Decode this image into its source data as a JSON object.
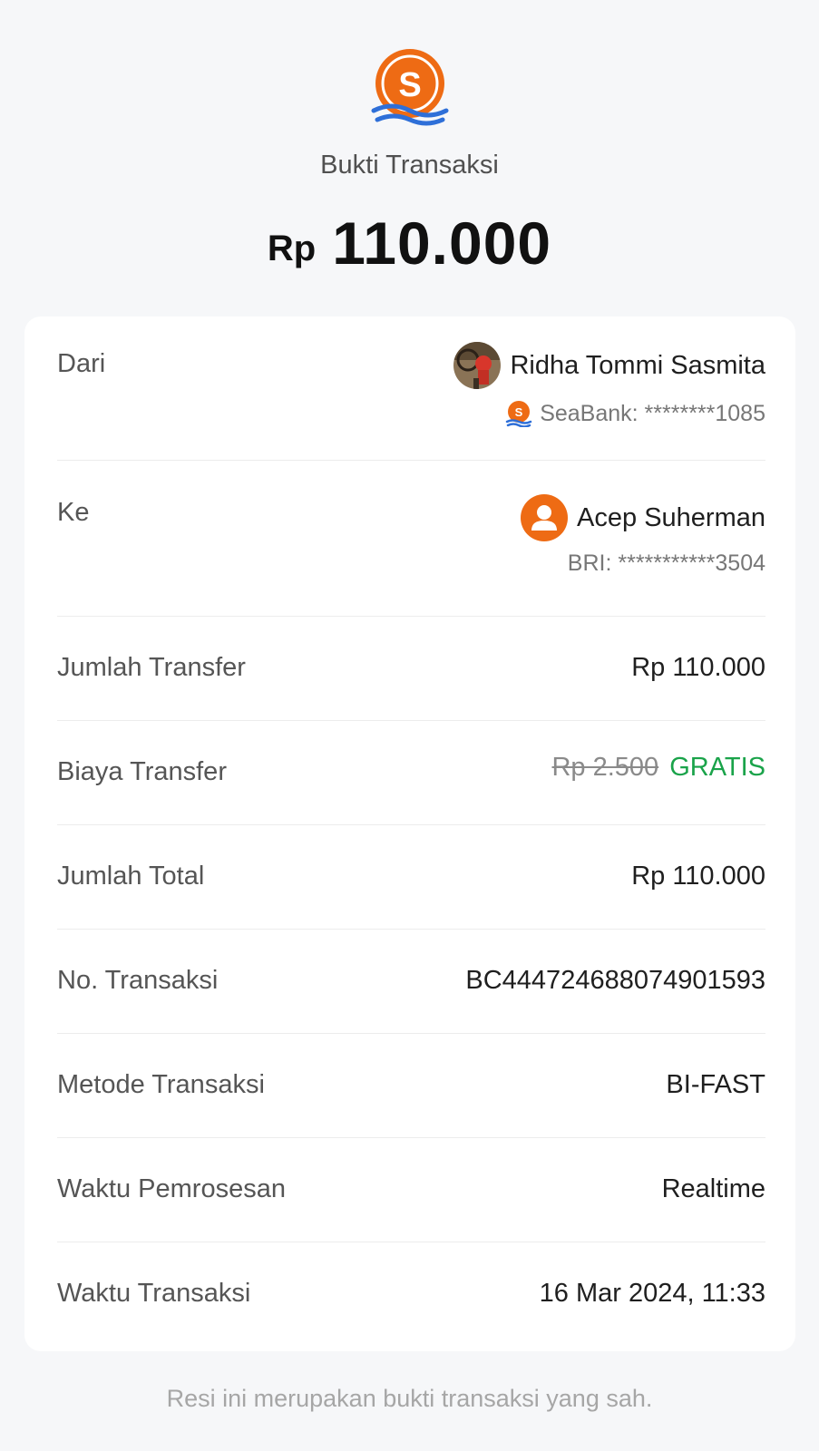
{
  "header": {
    "title": "Bukti Transaksi",
    "currency": "Rp",
    "amount": "110.000",
    "brand_color": "#EE6B14",
    "wave_color": "#2E6FD8"
  },
  "from": {
    "label": "Dari",
    "name": "Ridha Tommi Sasmita",
    "account": "SeaBank: ********1085",
    "avatar_icon": "profile-photo",
    "bank_icon": "seabank-logo-icon"
  },
  "to": {
    "label": "Ke",
    "name": "Acep Suherman",
    "account": "BRI: ***********3504",
    "avatar_icon": "user-avatar-icon"
  },
  "details": {
    "jumlah_transfer": {
      "label": "Jumlah Transfer",
      "value": "Rp 110.000"
    },
    "biaya_transfer": {
      "label": "Biaya Transfer",
      "original": "Rp 2.500",
      "discounted": "GRATIS",
      "discount_color": "#1AA34A"
    },
    "jumlah_total": {
      "label": "Jumlah Total",
      "value": "Rp 110.000"
    },
    "no_transaksi": {
      "label": "No. Transaksi",
      "value": "BC444724688074901593"
    },
    "metode_transaksi": {
      "label": "Metode Transaksi",
      "value": "BI-FAST"
    },
    "waktu_pemrosesan": {
      "label": "Waktu Pemrosesan",
      "value": "Realtime"
    },
    "waktu_transaksi": {
      "label": "Waktu Transaksi",
      "value": "16 Mar 2024, 11:33"
    }
  },
  "footer": {
    "note": "Resi ini merupakan bukti transaksi yang sah."
  }
}
